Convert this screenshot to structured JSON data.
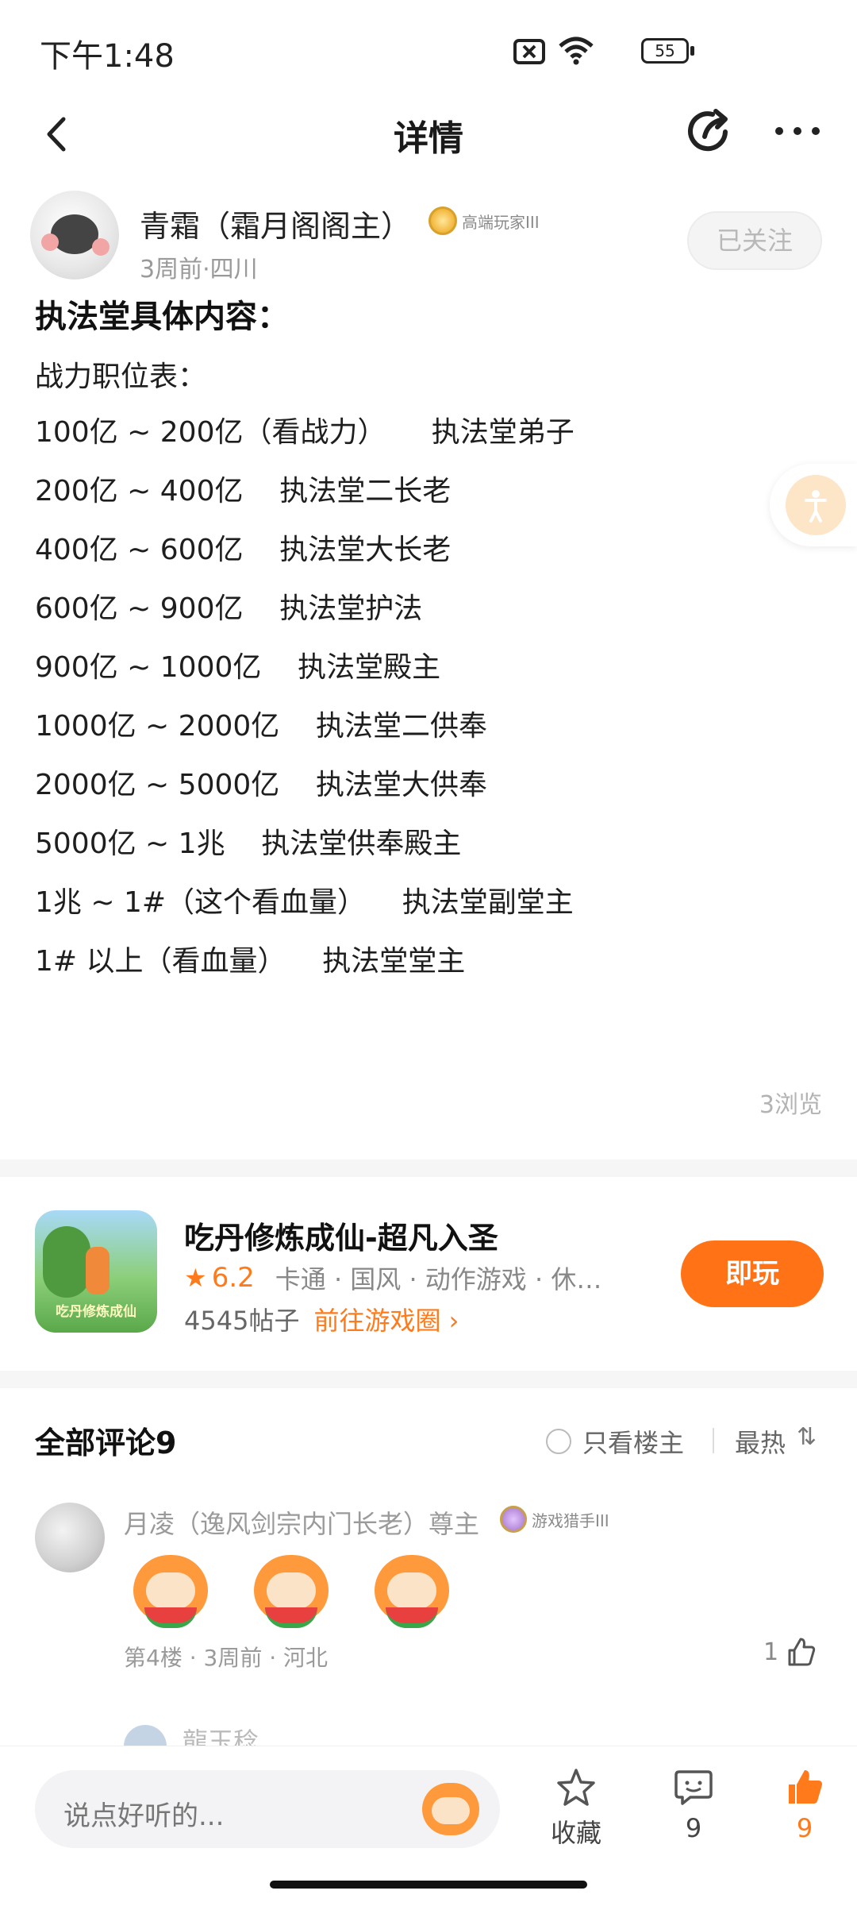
{
  "status_bar": {
    "time": "下午1:48",
    "battery": "55"
  },
  "nav": {
    "title": "详情"
  },
  "author": {
    "name": "青霜（霜月阁阁主）",
    "badge": "高端玩家III",
    "meta": "3周前·四川",
    "follow_label": "已关注"
  },
  "article": {
    "heading": "执法堂具体内容：",
    "lines": [
      "战力职位表：",
      "100亿 ~ 200亿（看战力）     执法堂弟子",
      "200亿 ~ 400亿    执法堂二长老",
      "400亿 ~ 600亿    执法堂大长老",
      "600亿 ~ 900亿    执法堂护法",
      "900亿 ~ 1000亿    执法堂殿主",
      "1000亿 ~ 2000亿    执法堂二供奉",
      "2000亿 ~ 5000亿    执法堂大供奉",
      "5000亿 ~ 1兆    执法堂供奉殿主",
      "1兆 ~ 1#（这个看血量）    执法堂副堂主",
      "1# 以上（看血量）    执法堂堂主"
    ],
    "views": "3浏览"
  },
  "game": {
    "icon_caption": "吃丹修炼成仙",
    "title": "吃丹修炼成仙-超凡入圣",
    "rating": "6.2",
    "tags": "卡通 · 国风 · 动作游戏 · 休…",
    "posts": "4545帖子",
    "link": "前往游戏圈 ›",
    "play_label": "即玩"
  },
  "comments": {
    "title": "全部评论9",
    "only_op": "只看楼主",
    "sort": "最热",
    "sort_icon": "⇅",
    "items": [
      {
        "name": "月凌（逸风剑宗内门长老）尊主",
        "badge": "游戏猎手III",
        "meta": "第4楼 · 3周前 · 河北",
        "likes": "1"
      }
    ],
    "next_name": "龍玉稔"
  },
  "bottom_bar": {
    "input_placeholder": "说点好听的...",
    "favorite_label": "收藏",
    "comment_count": "9",
    "like_count": "9"
  },
  "colors": {
    "accent": "#ff7316",
    "link": "#ff7a1a"
  }
}
